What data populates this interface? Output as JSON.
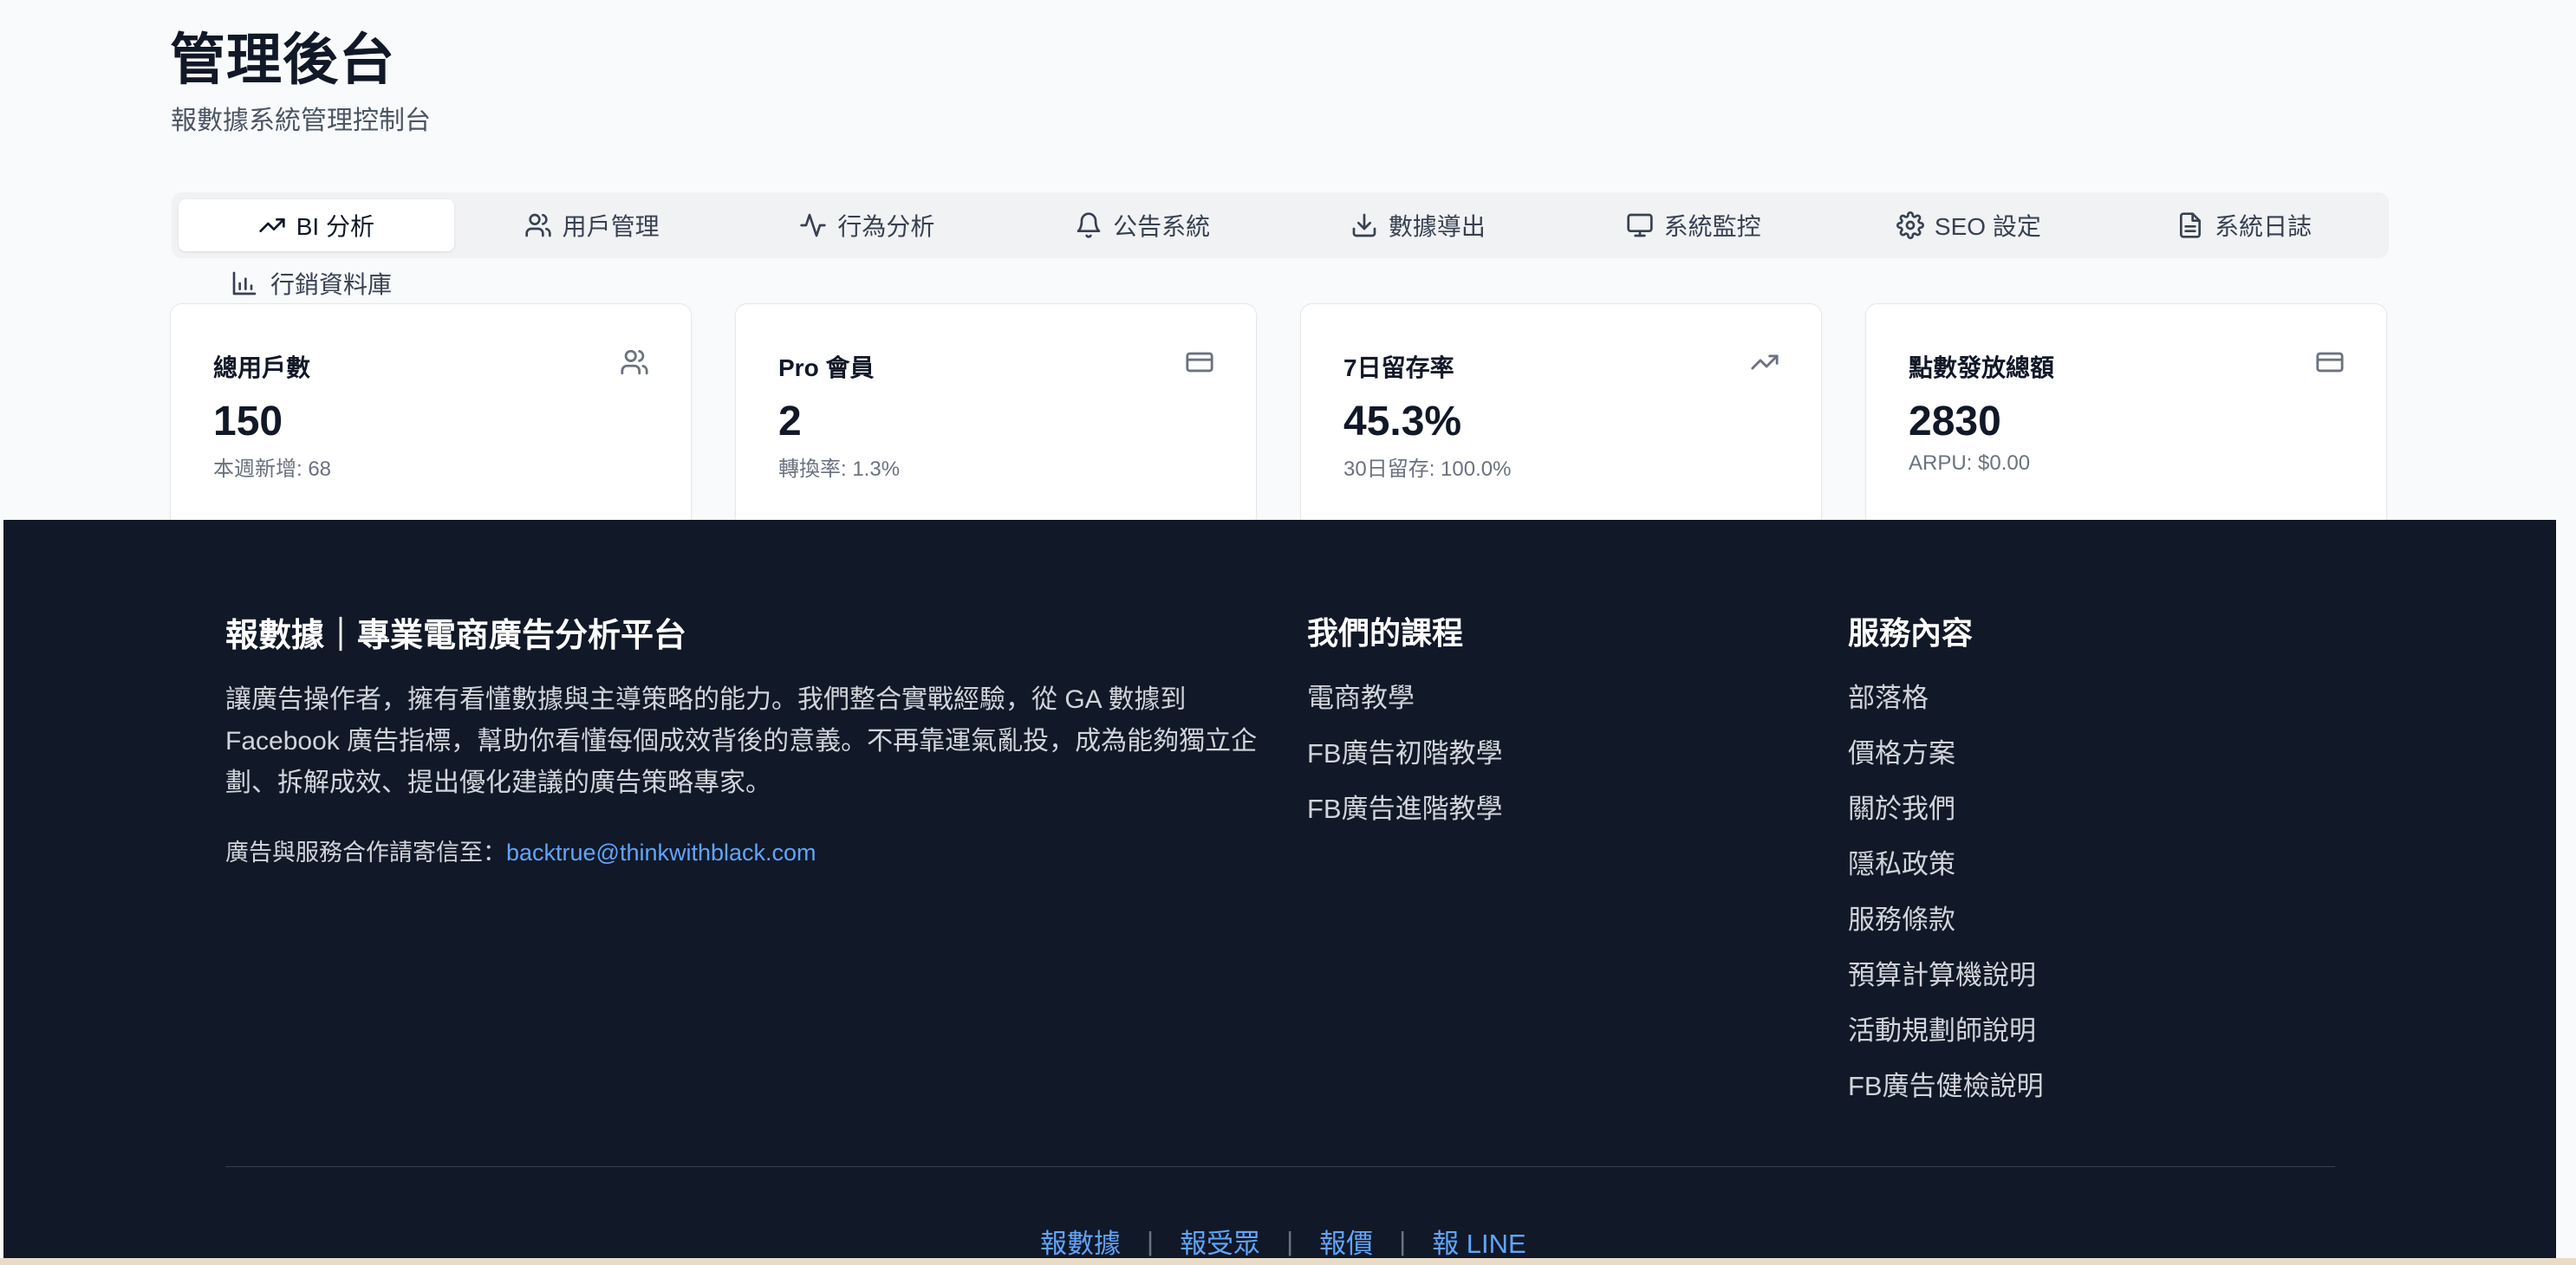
{
  "header": {
    "title": "管理後台",
    "subtitle": "報數據系統管理控制台"
  },
  "tabs": [
    {
      "label": "BI 分析",
      "icon": "trending-up-icon",
      "active": true
    },
    {
      "label": "用戶管理",
      "icon": "users-icon",
      "active": false
    },
    {
      "label": "行為分析",
      "icon": "activity-icon",
      "active": false
    },
    {
      "label": "公告系統",
      "icon": "bell-icon",
      "active": false
    },
    {
      "label": "數據導出",
      "icon": "download-icon",
      "active": false
    },
    {
      "label": "系統監控",
      "icon": "monitor-icon",
      "active": false
    },
    {
      "label": "SEO 設定",
      "icon": "gear-icon",
      "active": false
    },
    {
      "label": "系統日誌",
      "icon": "file-text-icon",
      "active": false
    }
  ],
  "tab_extra": {
    "label": "行銷資料庫",
    "icon": "bar-chart-icon"
  },
  "stats": [
    {
      "label": "總用戶數",
      "value": "150",
      "sub": "本週新增: 68",
      "icon": "users-icon"
    },
    {
      "label": "Pro 會員",
      "value": "2",
      "sub": "轉換率: 1.3%",
      "icon": "credit-card-icon"
    },
    {
      "label": "7日留存率",
      "value": "45.3%",
      "sub": "30日留存: 100.0%",
      "icon": "trending-up-icon"
    },
    {
      "label": "點數發放總額",
      "value": "2830",
      "sub": "ARPU: $0.00",
      "icon": "credit-card-icon"
    }
  ],
  "footer": {
    "brand_title": "報數據｜專業電商廣告分析平台",
    "description": "讓廣告操作者，擁有看懂數據與主導策略的能力。我們整合實戰經驗，從 GA 數據到 Facebook 廣告指標，幫助你看懂每個成效背後的意義。不再靠運氣亂投，成為能夠獨立企劃、拆解成效、提出優化建議的廣告策略專家。",
    "contact_prefix": "廣告與服務合作請寄信至：",
    "contact_email": "backtrue@thinkwithblack.com",
    "courses": {
      "title": "我們的課程",
      "items": [
        "電商教學",
        "FB廣告初階教學",
        "FB廣告進階教學"
      ]
    },
    "services": {
      "title": "服務內容",
      "items": [
        "部落格",
        "價格方案",
        "關於我們",
        "隱私政策",
        "服務條款",
        "預算計算機說明",
        "活動規劃師說明",
        "FB廣告健檢說明"
      ]
    },
    "bottom_links": [
      "報數據",
      "報受眾",
      "報價",
      "報 LINE"
    ],
    "bottom_separator": "|"
  },
  "colors": {
    "background": "#f9fafb",
    "footer_bg": "#111827",
    "link": "#60a5fa",
    "text": "#111827"
  }
}
